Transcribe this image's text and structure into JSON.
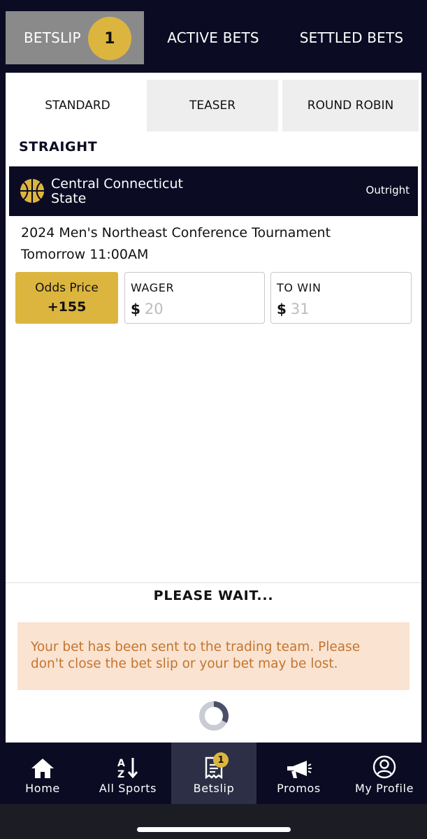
{
  "top_tabs": {
    "betslip_label": "BETSLIP",
    "betslip_count": "1",
    "active_label": "ACTIVE BETS",
    "settled_label": "SETTLED BETS"
  },
  "sub_tabs": {
    "standard": "STANDARD",
    "teaser": "TEASER",
    "round_robin": "ROUND ROBIN"
  },
  "bet": {
    "type_title": "STRAIGHT",
    "team_line1": "Central Connecticut",
    "team_line2": "State",
    "market": "Outright",
    "event": "2024 Men's Northeast Conference Tournament",
    "time": "Tomorrow 11:00AM",
    "odds_label": "Odds Price",
    "odds_value": "+155",
    "wager_label": "WAGER",
    "wager_currency": "$",
    "wager_placeholder": "20",
    "towin_label": "TO WIN",
    "towin_currency": "$",
    "towin_placeholder": "31"
  },
  "status": {
    "title": "PLEASE WAIT...",
    "message": "Your bet has been sent to the trading team. Please don't close the bet slip or your bet may be lost."
  },
  "bottom_nav": {
    "home": "Home",
    "all_sports": "All Sports",
    "betslip": "Betslip",
    "betslip_count": "1",
    "promos": "Promos",
    "my_profile": "My Profile"
  },
  "colors": {
    "navy": "#0b0b23",
    "gold": "#dcb53f",
    "notice_bg": "#fae3d1",
    "notice_text": "#c3752f"
  }
}
